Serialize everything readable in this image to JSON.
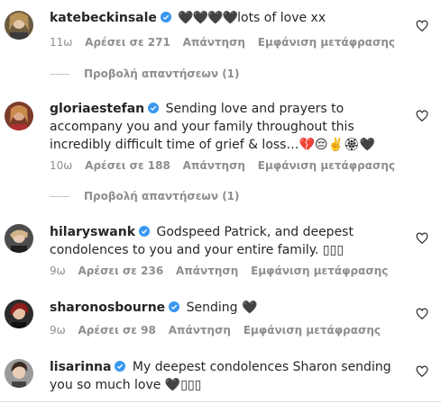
{
  "comments": [
    {
      "user": "katebeckinsale",
      "text": "lots of love xx",
      "prefix_emoji": "🖤🖤🖤🖤",
      "time": "11ω",
      "likes": "Αρέσει σε 271",
      "reply": "Απάντηση",
      "translate": "Εμφάνιση μετάφρασης",
      "view_replies": "Προβολή απαντήσεων (1)"
    },
    {
      "user": "gloriaestefan",
      "text": "Sending love and prayers to accompany you and your family throughout this incredibly difficult time of grief & loss…💔😔✌️🏵🖤",
      "time": "10ω",
      "likes": "Αρέσει σε 188",
      "reply": "Απάντηση",
      "translate": "Εμφάνιση μετάφρασης",
      "view_replies": "Προβολή απαντήσεων (1)"
    },
    {
      "user": "hilaryswank",
      "text": "Godspeed Patrick, and deepest condolences to you and your entire family. ▯▯▯",
      "time": "9ω",
      "likes": "Αρέσει σε 236",
      "reply": "Απάντηση",
      "translate": "Εμφάνιση μετάφρασης"
    },
    {
      "user": "sharonosbourne",
      "text": "Sending 🖤",
      "time": "9ω",
      "likes": "Αρέσει σε 98",
      "reply": "Απάντηση",
      "translate": "Εμφάνιση μετάφρασης"
    },
    {
      "user": "lisarinna",
      "text": "My deepest condolences Sharon sending you so much love 🖤▯▯▯"
    }
  ],
  "colors": {
    "verified": "#3897f0",
    "meta": "#8e8e8e",
    "text": "#262626"
  },
  "icons": {
    "like": "heart-outline-icon",
    "verified": "verified-badge-icon"
  }
}
